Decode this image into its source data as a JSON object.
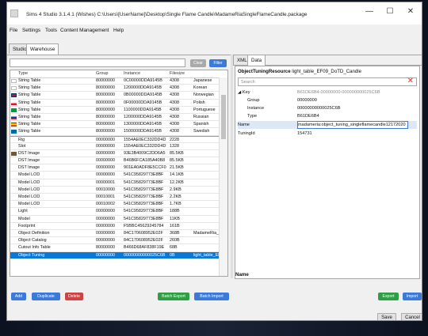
{
  "window": {
    "title": "Sims 4 Studio 3.1.4.1 (Wishes)  C:\\Users\\[UserName]\\Desktop\\Single Flame Candle\\MadameRiaSingleFlameCandle.package",
    "minimize": "—",
    "maximize": "☐",
    "close": "✕"
  },
  "menu": [
    "File",
    "Settings",
    "Tools",
    "Content Management",
    "Help"
  ],
  "tabs": [
    "Studio",
    "Warehouse"
  ],
  "left": {
    "search_value": "",
    "clear_label": "Clear",
    "filter_label": "Filter",
    "columns": [
      "Type",
      "Group",
      "Instance",
      "Filesize"
    ],
    "rows": [
      {
        "type": "String Table",
        "group": "80000000",
        "instance": "0C00000DDA9145B",
        "size": "4308",
        "name": "Japanese"
      },
      {
        "type": "String Table",
        "group": "80000000",
        "instance": "1200000DDA9145B",
        "size": "4308",
        "name": "Korean"
      },
      {
        "type": "String Table",
        "group": "80000000",
        "instance": "0B00000DDA9145B",
        "size": "4308",
        "name": "Norwegian"
      },
      {
        "type": "String Table",
        "group": "80000000",
        "instance": "0F00000DDA9145B",
        "size": "4308",
        "name": "Polish"
      },
      {
        "type": "String Table",
        "group": "80000000",
        "instance": "1100000DDA9145B",
        "size": "4308",
        "name": "Portuguese"
      },
      {
        "type": "String Table",
        "group": "80000000",
        "instance": "1200000DDA9145B",
        "size": "4308",
        "name": "Russian"
      },
      {
        "type": "String Table",
        "group": "80000000",
        "instance": "1300000DDA9145B",
        "size": "4308",
        "name": "Spanish"
      },
      {
        "type": "String Table",
        "group": "80000000",
        "instance": "1500000DDA9145B",
        "size": "4308",
        "name": "Swedish"
      },
      {
        "type": "Rig",
        "group": "00000000",
        "instance": "1554AE0EC332DD4D",
        "size": "2228",
        "name": ""
      },
      {
        "type": "Slot",
        "group": "00000000",
        "instance": "1554AE0EC332DD4D",
        "size": "1328",
        "name": ""
      },
      {
        "type": "DST Image",
        "group": "00000000",
        "instance": "93E3B4009C2DD6A5",
        "size": "85.5KB",
        "name": ""
      },
      {
        "type": "DST Image",
        "group": "00000000",
        "instance": "B46B6FCA185A40B8",
        "size": "85.5KB",
        "name": ""
      },
      {
        "type": "DST Image",
        "group": "00000000",
        "instance": "901EA0ADF8E5CCF0",
        "size": "21.5KB",
        "name": ""
      },
      {
        "type": "Model LOD",
        "group": "00000000",
        "instance": "541C95829773E8BF",
        "size": "14.1KB",
        "name": ""
      },
      {
        "type": "Model LOD",
        "group": "00000001",
        "instance": "541C95829773E8BF",
        "size": "12.2KB",
        "name": ""
      },
      {
        "type": "Model LOD",
        "group": "00010000",
        "instance": "541C95829773E8BF",
        "size": "2.9KB",
        "name": ""
      },
      {
        "type": "Model LOD",
        "group": "00010001",
        "instance": "541C95829773E8BF",
        "size": "2.2KB",
        "name": ""
      },
      {
        "type": "Model LOD",
        "group": "00010002",
        "instance": "541C95829773E8BF",
        "size": "1.7KB",
        "name": ""
      },
      {
        "type": "Light",
        "group": "00000000",
        "instance": "541C95829773E8BF",
        "size": "188B",
        "name": ""
      },
      {
        "type": "Model",
        "group": "00000000",
        "instance": "541C95829773E8BF",
        "size": "11KB",
        "name": ""
      },
      {
        "type": "Footprint",
        "group": "00000000",
        "instance": "F5BBC45629245784",
        "size": "161B",
        "name": ""
      },
      {
        "type": "Object Definition",
        "group": "00000000",
        "instance": "84C170608952E02F",
        "size": "368B",
        "name": "MadameRia_lig"
      },
      {
        "type": "Object Catalog",
        "group": "00000000",
        "instance": "84C170608952E02F",
        "size": "260B",
        "name": ""
      },
      {
        "type": "Cutout Info Table",
        "group": "80000000",
        "instance": "B466D68AF838F19E",
        "size": "68B",
        "name": ""
      },
      {
        "type": "Object Tuning",
        "group": "00000000",
        "instance": "00000000000025C6B",
        "size": "0B",
        "name": "light_table_EF0"
      }
    ]
  },
  "right": {
    "tabs": [
      "XML",
      "Data"
    ],
    "resource_type": "ObjectTuningResource",
    "resource_name": "light_table_EF09_DoTD_Candle",
    "search_placeholder": "Search",
    "props": [
      {
        "label": "◢ Key",
        "value": "B61DE6B4-00000000-000000000025C6B",
        "gray": true
      },
      {
        "label": "Group",
        "value": "00000000",
        "gray": false
      },
      {
        "label": "Instance",
        "value": "00000000000025C6B",
        "gray": false
      },
      {
        "label": "Type",
        "value": "B61DE6B4",
        "gray": false
      },
      {
        "label": "Name",
        "value": "madameria:object_tuning_singleflamecandle12172020",
        "gray": false
      },
      {
        "label": "TuningId",
        "value": "154731",
        "gray": false
      }
    ],
    "desc_title": "Name"
  },
  "buttons": {
    "add": "Add",
    "duplicate": "Duplicate",
    "delete": "Delete",
    "batch_export": "Batch Export",
    "batch_import": "Batch Import",
    "export": "Export",
    "import": "Import",
    "save": "Save",
    "cancel": "Cancel"
  },
  "colors": {
    "accent": "#3b7ad8",
    "selected_row": "#0a78d7",
    "delete": "#cc4444",
    "export": "#2f9e44"
  }
}
